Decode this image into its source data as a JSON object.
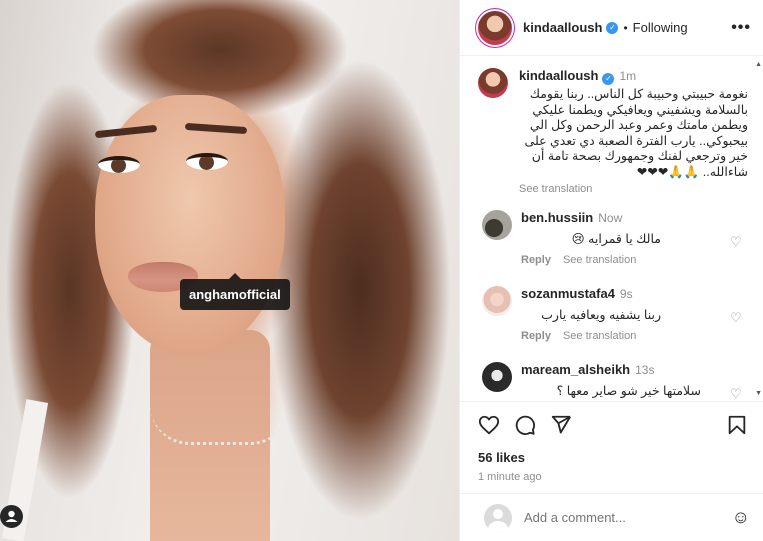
{
  "photo": {
    "tag_label": "anghamofficial",
    "tag_button_icon": "user-icon"
  },
  "header": {
    "username": "kindaalloush",
    "separator": "•",
    "follow_status": "Following",
    "more_icon": "•••"
  },
  "caption": {
    "username": "kindaalloush",
    "time": "1m",
    "text": "نغومة حبيبتي وحبيبة كل الناس.. ربنا يقومك بالسلامة ويشفيني ويعافيكي ويطمنا عليكي ويطمن مامتك وعمر وعبد الرحمن وكل الي بيحبوكي.. يارب الفترة الصعبة دي تعدي على خير وترجعي لفنك وجمهورك بصحة تامة أن شاءالله.. 🙏🙏❤❤❤",
    "see_translation": "See translation"
  },
  "comments": [
    {
      "username": "ben.hussiin",
      "time": "Now",
      "text": "مالك يا قمرايه 😢",
      "reply": "Reply",
      "see_translation": "See translation"
    },
    {
      "username": "sozanmustafa4",
      "time": "9s",
      "text": "ربنا يشفيه ويعافيه يارب",
      "reply": "Reply",
      "see_translation": "See translation"
    },
    {
      "username": "maream_alsheikh",
      "time": "13s",
      "text": "سلامتها خير شو صاير معها ؟"
    }
  ],
  "footer": {
    "likes": "56 likes",
    "time_ago": "1 minute ago",
    "add_comment_placeholder": "Add a comment...",
    "emoji_icon": "☺"
  }
}
